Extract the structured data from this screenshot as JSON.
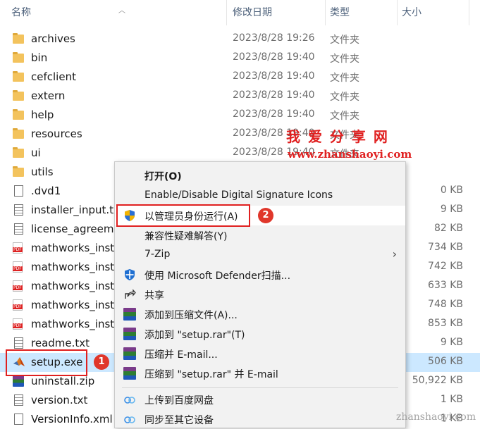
{
  "columns": {
    "name": "名称",
    "date": "修改日期",
    "type": "类型",
    "size": "大小"
  },
  "files": [
    {
      "name": "archives",
      "date": "2023/8/28 19:26",
      "type": "文件夹",
      "size": "",
      "icon": "folder-icon"
    },
    {
      "name": "bin",
      "date": "2023/8/28 19:40",
      "type": "文件夹",
      "size": "",
      "icon": "folder-icon"
    },
    {
      "name": "cefclient",
      "date": "2023/8/28 19:40",
      "type": "文件夹",
      "size": "",
      "icon": "folder-icon"
    },
    {
      "name": "extern",
      "date": "2023/8/28 19:40",
      "type": "文件夹",
      "size": "",
      "icon": "folder-icon"
    },
    {
      "name": "help",
      "date": "2023/8/28 19:40",
      "type": "文件夹",
      "size": "",
      "icon": "folder-icon"
    },
    {
      "name": "resources",
      "date": "2023/8/28 19:40",
      "type": "文件夹",
      "size": "",
      "icon": "folder-icon"
    },
    {
      "name": "ui",
      "date": "2023/8/28 19:40",
      "type": "文件夹",
      "size": "",
      "icon": "folder-icon"
    },
    {
      "name": "utils",
      "date": "",
      "type": "",
      "size": "",
      "icon": "folder-icon"
    },
    {
      "name": ".dvd1",
      "date": "",
      "type": "",
      "size": "0 KB",
      "icon": "file-icon"
    },
    {
      "name": "installer_input.txt",
      "date": "",
      "type": "",
      "size": "9 KB",
      "icon": "text-file-icon"
    },
    {
      "name": "license_agreement",
      "date": "",
      "type": "",
      "size": "82 KB",
      "icon": "text-file-icon"
    },
    {
      "name": "mathworks_insta",
      "date": "",
      "type": "",
      "size": "734 KB",
      "icon": "pdf-icon"
    },
    {
      "name": "mathworks_insta",
      "date": "",
      "type": "",
      "size": "742 KB",
      "icon": "pdf-icon"
    },
    {
      "name": "mathworks_insta",
      "date": "",
      "type": "",
      "size": "633 KB",
      "icon": "pdf-icon"
    },
    {
      "name": "mathworks_insta",
      "date": "",
      "type": "",
      "size": "748 KB",
      "icon": "pdf-icon"
    },
    {
      "name": "mathworks_insta",
      "date": "",
      "type": "",
      "size": "853 KB",
      "icon": "pdf-icon"
    },
    {
      "name": "readme.txt",
      "date": "",
      "type": "",
      "size": "9 KB",
      "icon": "text-file-icon"
    },
    {
      "name": "setup.exe",
      "date": "",
      "type": "",
      "size": "506 KB",
      "icon": "matlab-icon"
    },
    {
      "name": "uninstall.zip",
      "date": "",
      "type": "",
      "size": "50,922 KB",
      "icon": "zip-icon"
    },
    {
      "name": "version.txt",
      "date": "",
      "type": "",
      "size": "1 KB",
      "icon": "text-file-icon"
    },
    {
      "name": "VersionInfo.xml",
      "date": "",
      "type": "",
      "size": "1 KB",
      "icon": "file-icon"
    }
  ],
  "selected_file": "setup.exe",
  "context_menu": {
    "open": "打开(O)",
    "signature": "Enable/Disable Digital Signature Icons",
    "run_as_admin": "以管理员身份运行(A)",
    "compat": "兼容性疑难解答(Y)",
    "zip7": "7-Zip",
    "defender": "使用 Microsoft Defender扫描...",
    "share": "共享",
    "add_archive": "添加到压缩文件(A)...",
    "add_rar": "添加到 \"setup.rar\"(T)",
    "compress_email": "压缩并 E-mail...",
    "compress_rar_email": "压缩到 \"setup.rar\" 并 E-mail",
    "upload_baidu": "上传到百度网盘",
    "sync_other": "同步至其它设备"
  },
  "badges": {
    "one": "1",
    "two": "2"
  },
  "watermark": {
    "title": "我 爱 分 享 网",
    "url": "www.zhanshaoyi.com",
    "corner": "zhanshaoyi.com"
  },
  "colors": {
    "selection": "#cce8ff",
    "highlight_border": "#e02020",
    "badge": "#e0372b",
    "folder": "#f3c35d"
  }
}
